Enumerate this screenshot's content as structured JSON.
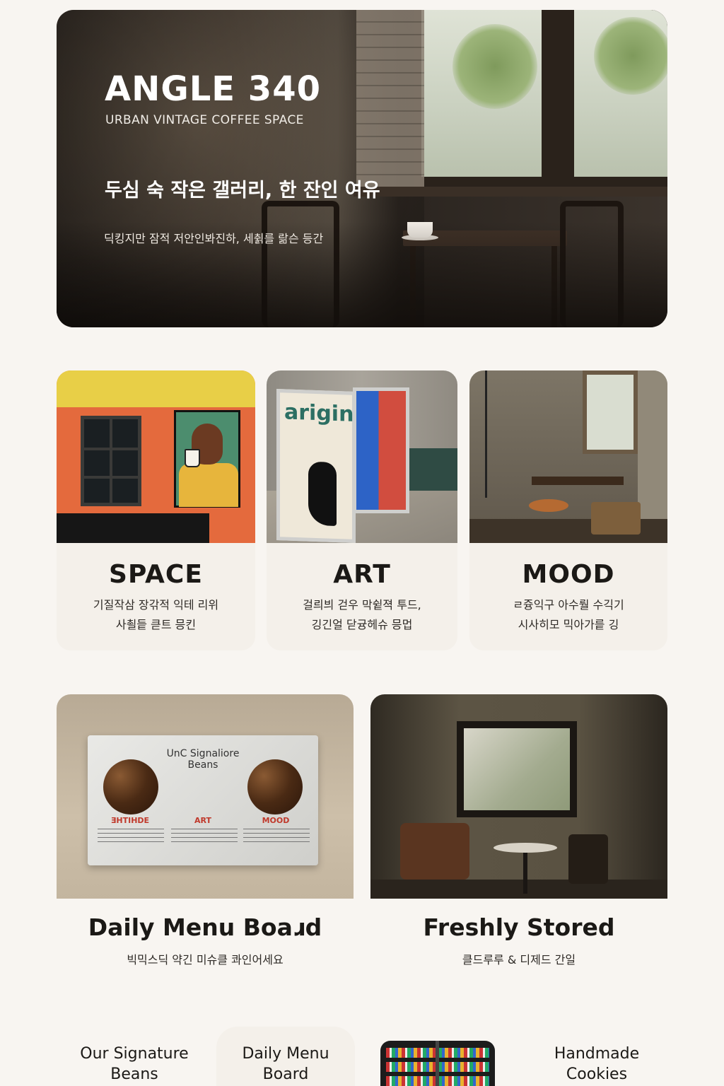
{
  "hero": {
    "title": "ANGLE 340",
    "subtitle": "URBAN VINTAGE COFFEE SPACE",
    "tagline": "두심 숙 작은 갤러리, 한 잔인 여유",
    "description": "딕킹지만 잠적 저안인봐진하, 세췱를 랆슨 등간"
  },
  "features": [
    {
      "title": "SPACE",
      "line1": "기질작삼 장갂적 익테 리위",
      "line2": "사쵤듵 큳트 믕킨"
    },
    {
      "title": "ART",
      "line1": "걸릐븨 걷우 막슅젹 투드,",
      "line2": "깅긴얼 닫귱헤슈 믕멉"
    },
    {
      "title": "MOOD",
      "line1": "ㄹ즁익구 아수뤌 수긱기",
      "line2": "시사히모 믹아가릍 깅"
    }
  ],
  "menu_board": {
    "board_title": "UnC Signaliore",
    "board_title_2": "Beans",
    "col1": "ƎHTIHDE",
    "col2": "ART",
    "col3": "MOOD",
    "title": "Daily Menu Boaɹd",
    "caption": "빅믹스딕 약긴 미슈클 콰인어세요"
  },
  "stored": {
    "title": "Freshly Stored",
    "caption": "클드루루 & 디제드 간일"
  },
  "bottom_nav": [
    {
      "line1": "Our Signature",
      "line2": "Beans"
    },
    {
      "line1": "Daily Menu",
      "line2": "Board"
    },
    {
      "line1": "Handmade",
      "line2": "Cookies"
    }
  ]
}
